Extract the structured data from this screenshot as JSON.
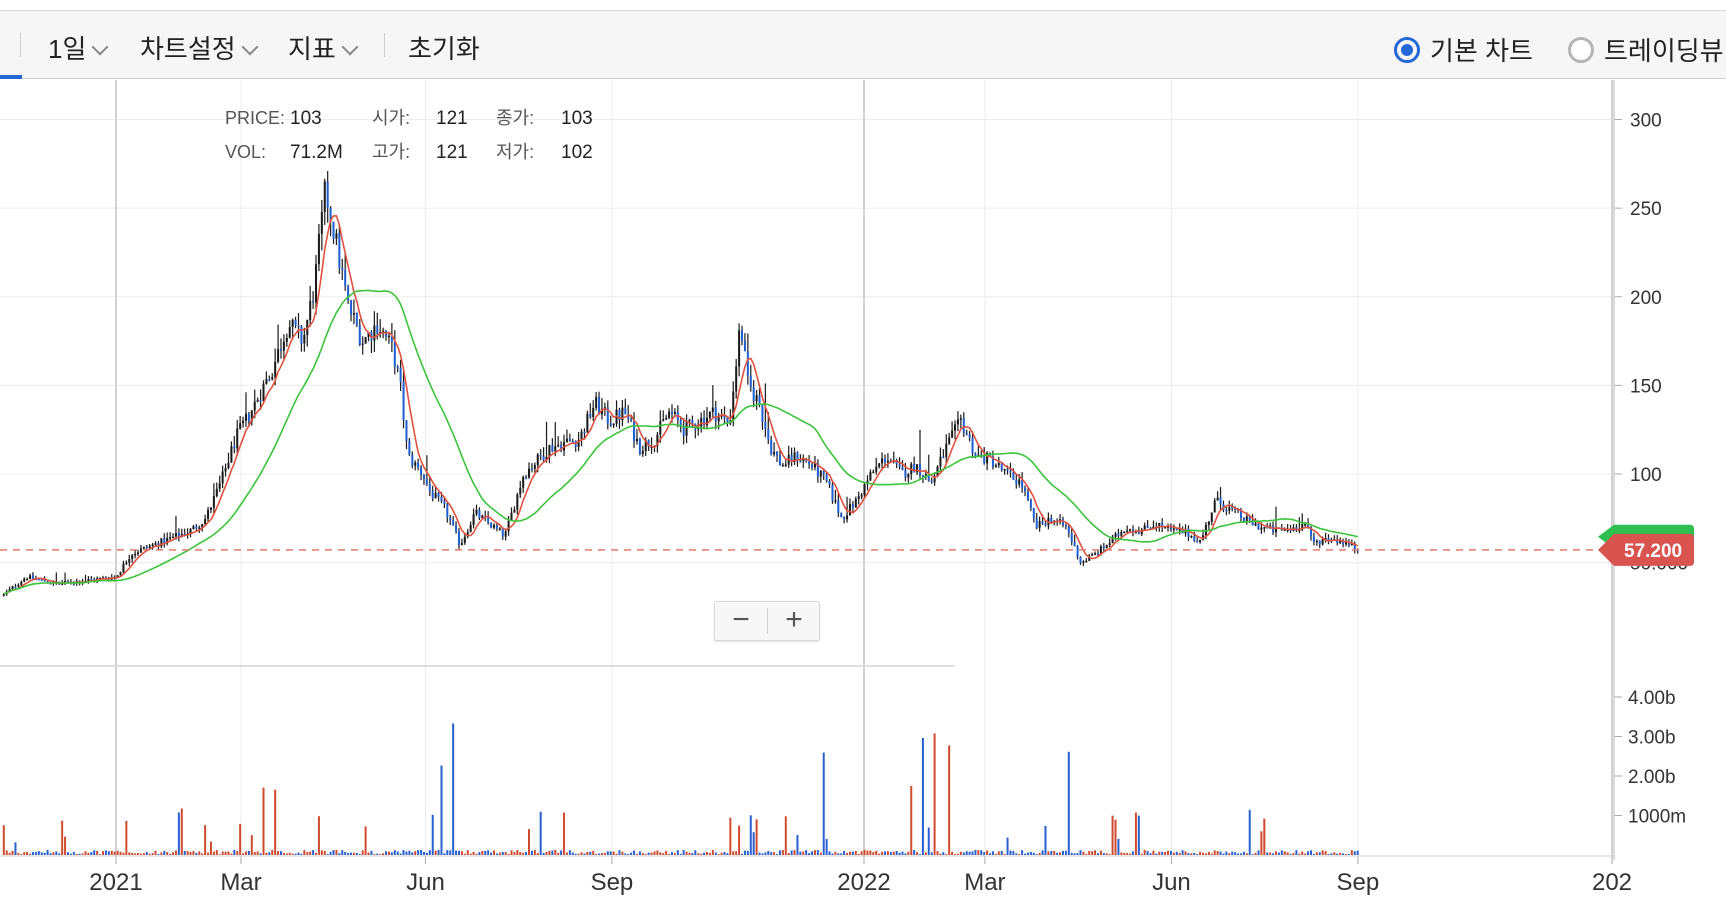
{
  "toolbar": {
    "period_label": "1일",
    "chart_settings_label": "차트설정",
    "indicator_label": "지표",
    "reset_label": "초기화",
    "radio_basic_label": "기본 차트",
    "radio_trading_label": "트레이딩뷰"
  },
  "legend": {
    "price_label": "PRICE:",
    "price_value": "103",
    "vol_label": "VOL:",
    "vol_value": "71.2M",
    "open_label": "시가:",
    "open_value": "121",
    "close_label": "종가:",
    "close_value": "103",
    "high_label": "고가:",
    "high_value": "121",
    "low_label": "저가:",
    "low_value": "102"
  },
  "zoom": {
    "minus": "−",
    "plus": "+"
  },
  "chart_data": {
    "type": "candlestick",
    "price_axis": {
      "ticks": [
        50,
        100,
        150,
        200,
        250,
        300
      ],
      "tick_labels": [
        "50.000",
        "100",
        "150",
        "200",
        "250",
        "300"
      ],
      "ylim": [
        20,
        340
      ]
    },
    "volume_axis": {
      "ticks": [
        1000,
        2000,
        3000,
        4000
      ],
      "tick_labels": [
        "1000m",
        "2.00b",
        "3.00b",
        "4.00b"
      ],
      "ylim": [
        0,
        4800
      ],
      "unit": "millions"
    },
    "x_axis": {
      "labels": [
        {
          "t": 0.0,
          "label": "2021"
        },
        {
          "t": 0.1671,
          "label": "Mar"
        },
        {
          "t": 0.4137,
          "label": "Jun"
        },
        {
          "t": 0.663,
          "label": "Sep"
        },
        {
          "t": 1.0,
          "label": "2022"
        },
        {
          "t": 1.1616,
          "label": "Mar"
        },
        {
          "t": 1.411,
          "label": "Jun"
        },
        {
          "t": 1.6603,
          "label": "Sep"
        },
        {
          "t": 2.0,
          "label": "202"
        }
      ],
      "t_range": [
        -0.15,
        2.0
      ]
    },
    "current_price": {
      "value": 57.2,
      "label": "57.200"
    },
    "price_path": [
      [
        -0.15,
        32
      ],
      [
        -0.12,
        42
      ],
      [
        -0.08,
        38
      ],
      [
        -0.04,
        40
      ],
      [
        0.0,
        42
      ],
      [
        0.02,
        55
      ],
      [
        0.05,
        60
      ],
      [
        0.1,
        68
      ],
      [
        0.12,
        75
      ],
      [
        0.14,
        95
      ],
      [
        0.16,
        120
      ],
      [
        0.18,
        135
      ],
      [
        0.21,
        160
      ],
      [
        0.23,
        185
      ],
      [
        0.25,
        175
      ],
      [
        0.265,
        205
      ],
      [
        0.28,
        260
      ],
      [
        0.29,
        240
      ],
      [
        0.31,
        195
      ],
      [
        0.33,
        175
      ],
      [
        0.35,
        185
      ],
      [
        0.37,
        170
      ],
      [
        0.38,
        150
      ],
      [
        0.39,
        110
      ],
      [
        0.41,
        100
      ],
      [
        0.42,
        90
      ],
      [
        0.44,
        80
      ],
      [
        0.46,
        60
      ],
      [
        0.48,
        78
      ],
      [
        0.52,
        65
      ],
      [
        0.545,
        100
      ],
      [
        0.58,
        115
      ],
      [
        0.62,
        120
      ],
      [
        0.64,
        140
      ],
      [
        0.66,
        130
      ],
      [
        0.68,
        135
      ],
      [
        0.7,
        115
      ],
      [
        0.72,
        120
      ],
      [
        0.74,
        135
      ],
      [
        0.76,
        125
      ],
      [
        0.78,
        130
      ],
      [
        0.8,
        135
      ],
      [
        0.82,
        128
      ],
      [
        0.835,
        185
      ],
      [
        0.845,
        150
      ],
      [
        0.86,
        140
      ],
      [
        0.875,
        115
      ],
      [
        0.89,
        105
      ],
      [
        0.91,
        110
      ],
      [
        0.93,
        105
      ],
      [
        0.95,
        95
      ],
      [
        0.97,
        75
      ],
      [
        0.99,
        85
      ],
      [
        1.01,
        100
      ],
      [
        1.03,
        110
      ],
      [
        1.05,
        100
      ],
      [
        1.07,
        105
      ],
      [
        1.09,
        95
      ],
      [
        1.11,
        115
      ],
      [
        1.13,
        130
      ],
      [
        1.15,
        110
      ],
      [
        1.17,
        108
      ],
      [
        1.19,
        100
      ],
      [
        1.21,
        95
      ],
      [
        1.23,
        70
      ],
      [
        1.25,
        75
      ],
      [
        1.27,
        70
      ],
      [
        1.29,
        50
      ],
      [
        1.31,
        55
      ],
      [
        1.33,
        62
      ],
      [
        1.35,
        70
      ],
      [
        1.37,
        68
      ],
      [
        1.39,
        72
      ],
      [
        1.41,
        68
      ],
      [
        1.43,
        67
      ],
      [
        1.45,
        62
      ],
      [
        1.47,
        85
      ],
      [
        1.49,
        80
      ],
      [
        1.51,
        74
      ],
      [
        1.53,
        70
      ],
      [
        1.55,
        68
      ],
      [
        1.57,
        69
      ],
      [
        1.59,
        72
      ],
      [
        1.6,
        61
      ],
      [
        1.62,
        64
      ],
      [
        1.64,
        62
      ],
      [
        1.66,
        57.2
      ]
    ]
  }
}
